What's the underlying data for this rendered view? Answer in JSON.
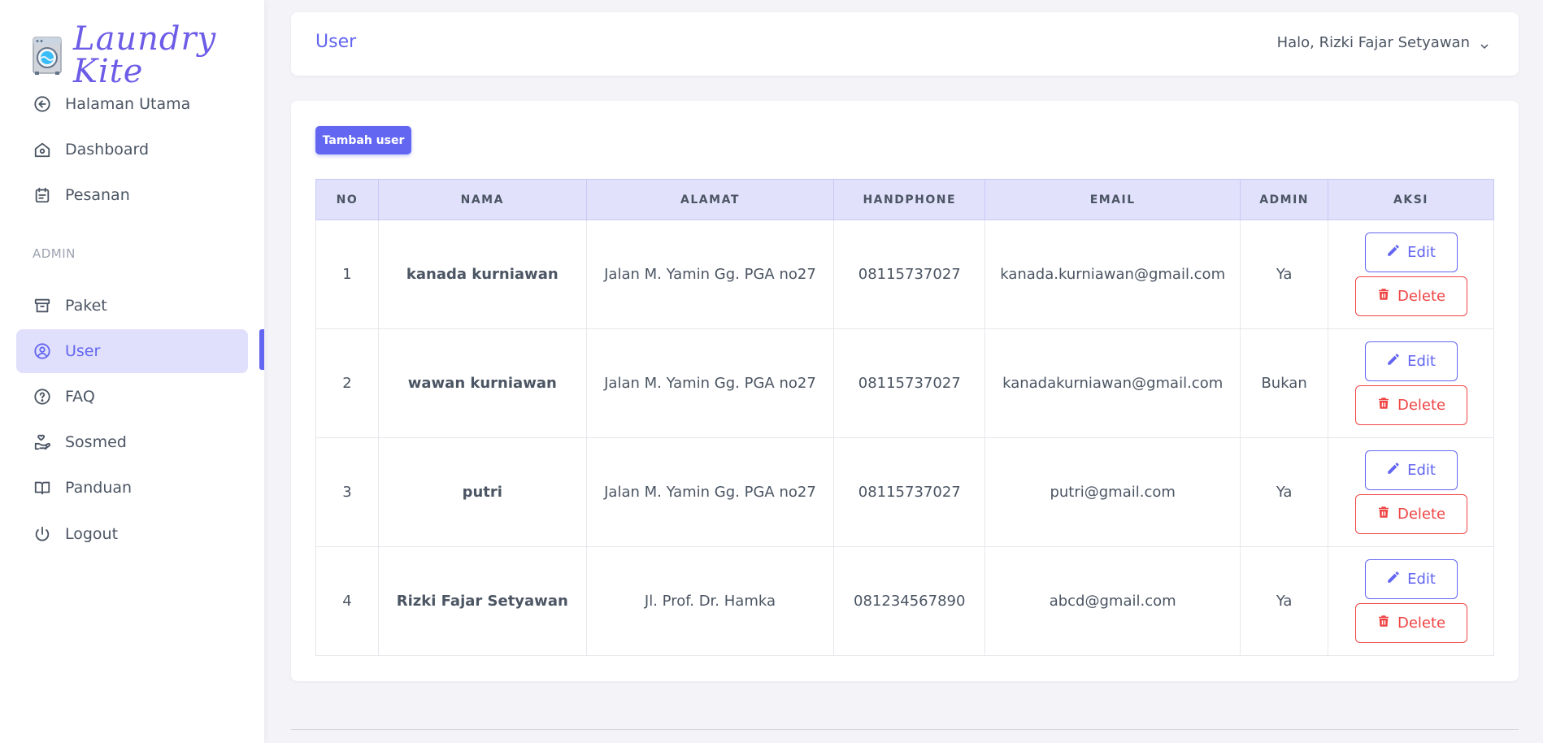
{
  "brand": {
    "name": "Laundry Kite"
  },
  "sidebar": {
    "items": [
      {
        "label": "Halaman Utama",
        "icon": "arrow-left-circle-icon"
      },
      {
        "label": "Dashboard",
        "icon": "home-icon"
      },
      {
        "label": "Pesanan",
        "icon": "calendar-icon"
      }
    ],
    "section_label": "ADMIN",
    "admin_items": [
      {
        "label": "Paket",
        "icon": "archive-icon"
      },
      {
        "label": "User",
        "icon": "user-circle-icon",
        "active": true
      },
      {
        "label": "FAQ",
        "icon": "question-circle-icon"
      },
      {
        "label": "Sosmed",
        "icon": "hand-heart-icon"
      },
      {
        "label": "Panduan",
        "icon": "book-open-icon"
      },
      {
        "label": "Logout",
        "icon": "power-icon"
      }
    ]
  },
  "header": {
    "title": "User",
    "greeting": "Halo, Rizki Fajar Setyawan"
  },
  "main": {
    "add_button": "Tambah user",
    "table": {
      "columns": [
        "NO",
        "NAMA",
        "ALAMAT",
        "HANDPHONE",
        "EMAIL",
        "ADMIN",
        "AKSI"
      ],
      "rows": [
        {
          "no": "1",
          "nama": "kanada kurniawan",
          "alamat": "Jalan M. Yamin Gg. PGA no27",
          "handphone": "08115737027",
          "email": "kanada.kurniawan@gmail.com",
          "admin": "Ya"
        },
        {
          "no": "2",
          "nama": "wawan kurniawan",
          "alamat": "Jalan M. Yamin Gg. PGA no27",
          "handphone": "08115737027",
          "email": "kanadakurniawan@gmail.com",
          "admin": "Bukan"
        },
        {
          "no": "3",
          "nama": "putri",
          "alamat": "Jalan M. Yamin Gg. PGA no27",
          "handphone": "08115737027",
          "email": "putri@gmail.com",
          "admin": "Ya"
        },
        {
          "no": "4",
          "nama": "Rizki Fajar Setyawan",
          "alamat": "Jl. Prof. Dr. Hamka",
          "handphone": "081234567890",
          "email": "abcd@gmail.com",
          "admin": "Ya"
        }
      ],
      "edit_label": "Edit",
      "delete_label": "Delete"
    }
  },
  "colors": {
    "accent": "#6366f1",
    "accent_light": "#e1e0fc",
    "danger": "#ef4444",
    "brand": "#6c5ce7"
  }
}
